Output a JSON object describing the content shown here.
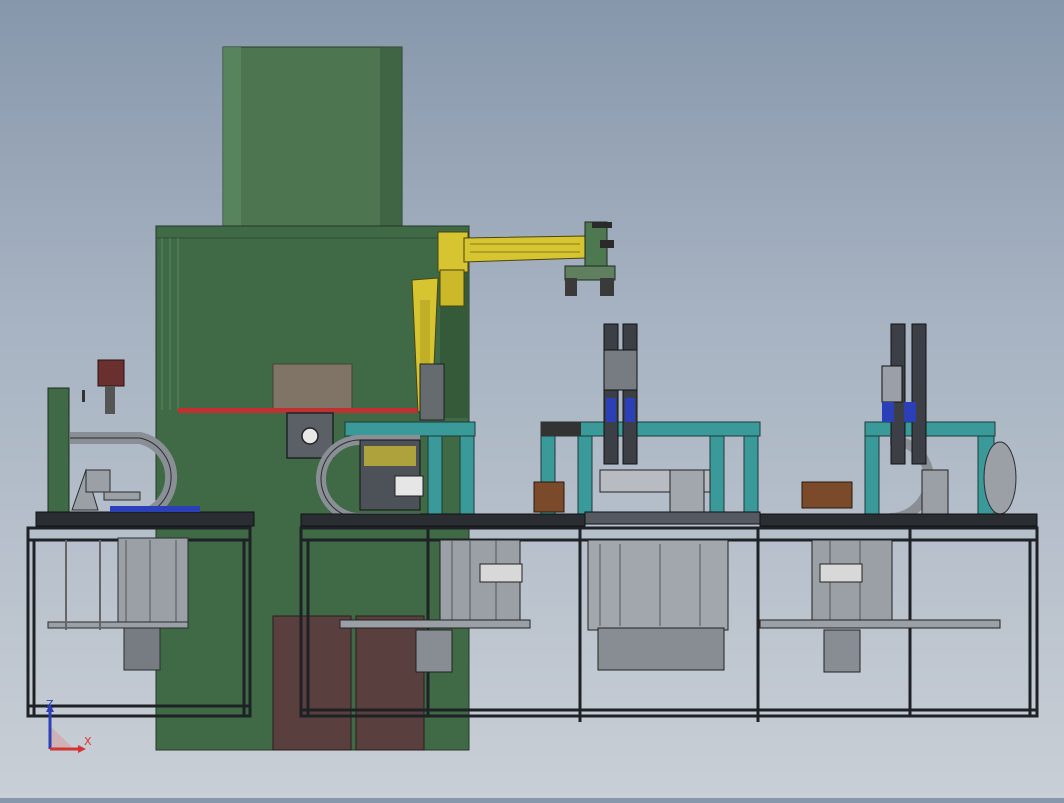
{
  "viewport": {
    "background_top": "#8797ab",
    "background_bottom": "#c9cfd6"
  },
  "triad": {
    "z_label": "Z",
    "x_label": "X",
    "z_color": "#2a3fb8",
    "x_color": "#d33333"
  },
  "colors": {
    "press_green": "#3f6a45",
    "tower_green": "#4c7550",
    "frame_dark": "#1e2226",
    "guard_teal": "#3a9a9a",
    "robot_yellow": "#d6c531",
    "steel": "#9aa0a6",
    "door_brown": "#5a3f3f",
    "accent_red": "#c03030",
    "blue_cylinder": "#2a3fb8",
    "box_brown": "#8a7a6a"
  }
}
